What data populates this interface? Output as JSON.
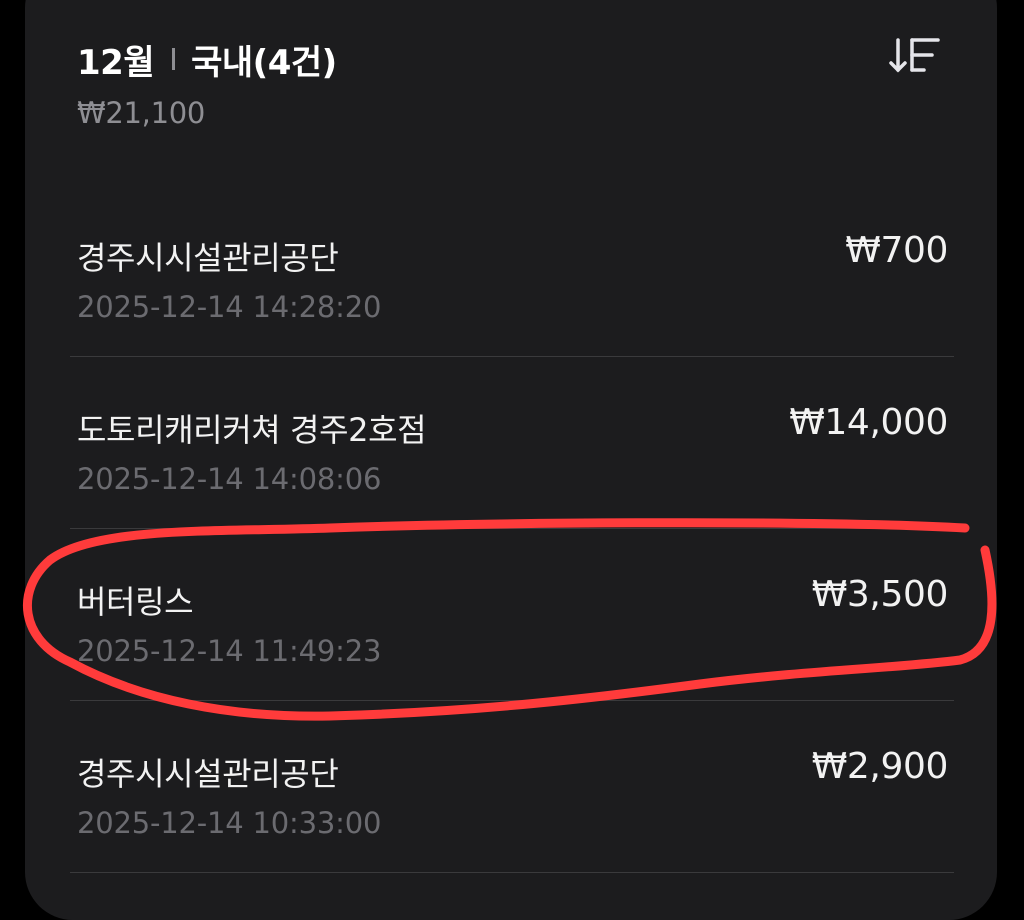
{
  "header": {
    "month": "12월",
    "category": "국내(4건)",
    "total": "₩21,100"
  },
  "icons": {
    "sort": "sort-icon"
  },
  "transactions": [
    {
      "merchant": "경주시시설관리공단",
      "datetime": "2025-12-14 14:28:20",
      "amount": "₩700"
    },
    {
      "merchant": "도토리캐리커쳐 경주2호점",
      "datetime": "2025-12-14 14:08:06",
      "amount": "₩14,000"
    },
    {
      "merchant": "버터링스",
      "datetime": "2025-12-14 11:49:23",
      "amount": "₩3,500"
    },
    {
      "merchant": "경주시시설관리공단",
      "datetime": "2025-12-14 10:33:00",
      "amount": "₩2,900"
    }
  ],
  "colors": {
    "background": "#000000",
    "card": "#1c1c1e",
    "primary_text": "#f2f2f2",
    "secondary_text": "#6b6b70",
    "divider": "#3a3a3c",
    "annotation": "#ff3b3b"
  }
}
